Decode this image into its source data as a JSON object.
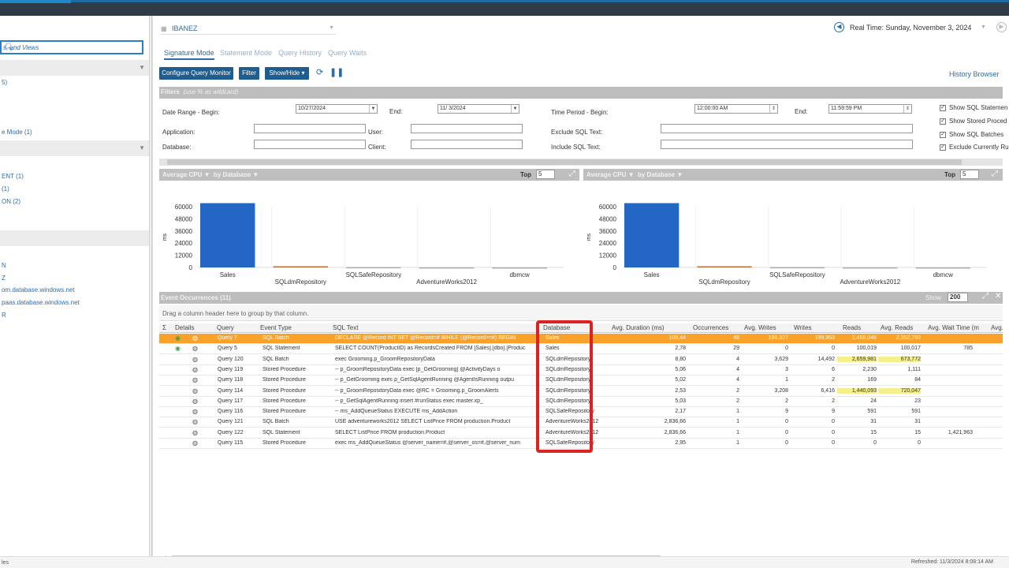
{
  "left_panel": {
    "search_placeholder": "s, and Views",
    "items": [
      {
        "label": "5)",
        "top": 80
      },
      {
        "label": "e Mode (1)",
        "top": 143
      },
      {
        "label": "ENT (1)",
        "top": 199
      },
      {
        "label": "(1)",
        "top": 215
      },
      {
        "label": "ON (2)",
        "top": 231
      },
      {
        "label": "N",
        "top": 312
      },
      {
        "label": "Z",
        "top": 328
      },
      {
        "label": "om.database.windows.net",
        "top": 343
      },
      {
        "label": "paas.database.windows.net",
        "top": 359
      },
      {
        "label": "R",
        "top": 375
      }
    ]
  },
  "header": {
    "server": "IBANEZ",
    "realtime": "Real Time: Sunday, November 3, 2024",
    "history_browser": "History Browser"
  },
  "tabs": [
    "Signature Mode",
    "Statement Mode",
    "Query History",
    "Query Waits"
  ],
  "toolbar": {
    "configure": "Configure Query Monitor",
    "filter": "Filter",
    "showhide": "Show/Hide ▾"
  },
  "filters": {
    "title": "Filters",
    "hint": "(use % as wildcard)",
    "date_begin_label": "Date Range - Begin:",
    "date_begin": "10/27/2024",
    "end_label": "End:",
    "date_end": "11/ 3/2024",
    "time_begin_label": "Time Period - Begin:",
    "time_begin": "12:00:00 AM",
    "time_end_label": "End:",
    "time_end": "11:59:59 PM",
    "application_label": "Application:",
    "user_label": "User:",
    "exclude_label": "Exclude SQL Text:",
    "database_label": "Database:",
    "client_label": "Client:",
    "include_label": "Include SQL Text:",
    "checks": [
      "Show SQL Statemen",
      "Show Stored Proced",
      "Show SQL Batches",
      "Exclude Currently Ru"
    ]
  },
  "chart_panels": [
    {
      "metric": "Average CPU",
      "by": "by Database",
      "top_label": "Top",
      "top_n": "5"
    },
    {
      "metric": "Average CPU",
      "by": "by Database",
      "top_label": "Top",
      "top_n": "5"
    }
  ],
  "chart_data": [
    {
      "type": "bar",
      "categories": [
        "Sales",
        "SQLdmRepository",
        "SQLSafeRepository",
        "AdventureWorks2012",
        "dbmcw"
      ],
      "values": [
        63500,
        1200,
        300,
        100,
        50
      ],
      "yticks": [
        "60000",
        "48000",
        "36000",
        "24000",
        "12000",
        "0"
      ],
      "ylabel": "ms",
      "ylim": [
        0,
        60000
      ],
      "colors": [
        "#2366c4",
        "#c0733a",
        "#a8a8a8",
        "#a8a8a8",
        "#a8a8a8"
      ]
    },
    {
      "type": "bar",
      "categories": [
        "Sales",
        "SQLdmRepository",
        "SQLSafeRepository",
        "AdventureWorks2012",
        "dbmcw"
      ],
      "values": [
        63500,
        1200,
        300,
        100,
        50
      ],
      "yticks": [
        "60000",
        "48000",
        "36000",
        "24000",
        "12000",
        "0"
      ],
      "ylabel": "ms",
      "ylim": [
        0,
        60000
      ],
      "colors": [
        "#2366c4",
        "#c0733a",
        "#a8a8a8",
        "#a8a8a8",
        "#a8a8a8"
      ]
    }
  ],
  "grid": {
    "title": "Event Occurrences (11)",
    "show_label": "Show",
    "show_n": "200",
    "group_hint": "Drag a column header here to group by that column.",
    "columns": [
      "Σ",
      "Details",
      "Query",
      "Event Type",
      "SQL Text",
      "Database",
      "Avg. Duration (ms)",
      "Occurrences",
      "Avg. Writes",
      "Writes",
      "Reads",
      "Avg. Reads",
      "Avg. Wait Time (m",
      "Avg."
    ],
    "rows": [
      {
        "query": "Query 7",
        "type": "SQL Batch",
        "sql": "DECLARE @Record INT  SET @Record=#  WHILE (@Record>=#)  BEGIN",
        "db": "Sales",
        "dur": "108,44",
        "occ": "48",
        "aw": "199,327",
        "w": "199,953",
        "r": "2,458,046",
        "ar": "2,352,793",
        "awt": ""
      },
      {
        "query": "Query 5",
        "type": "SQL Statement",
        "sql": "SELECT COUNT(ProductID) as RecordsCreated FROM [Sales].[dbo].[Produc",
        "db": "Sales",
        "dur": "2,78",
        "occ": "29",
        "aw": "0",
        "w": "0",
        "r": "100,019",
        "ar": "100,017",
        "awt": "785"
      },
      {
        "query": "Query 120",
        "type": "SQL Batch",
        "sql": "exec Grooming.p_GroomRepositoryData",
        "db": "SQLdmRepository",
        "dur": "8,80",
        "occ": "4",
        "aw": "3,629",
        "w": "14,492",
        "r": "2,659,981",
        "ar": "673,772",
        "awt": ""
      },
      {
        "query": "Query 119",
        "type": "Stored Procedure",
        "sql": "-- p_GroomRepositoryData exec [p_GetGrooming]      @ActivityDays o",
        "db": "SQLdmRepository",
        "dur": "5,06",
        "occ": "4",
        "aw": "3",
        "w": "6",
        "r": "2,230",
        "ar": "1,111",
        "awt": ""
      },
      {
        "query": "Query 118",
        "type": "Stored Procedure",
        "sql": "-- p_GetGrooming  exec p_GetSqlAgentRunning @AgentIsRunning outpu",
        "db": "SQLdmRepository",
        "dur": "5,02",
        "occ": "4",
        "aw": "1",
        "w": "2",
        "r": "169",
        "ar": "84",
        "awt": ""
      },
      {
        "query": "Query 114",
        "type": "Stored Procedure",
        "sql": "-- p_GroomRepositoryData exec @RC = Grooming.p_GroomAlerts",
        "db": "SQLdmRepository",
        "dur": "2,53",
        "occ": "2",
        "aw": "3,208",
        "w": "6,416",
        "r": "1,440,093",
        "ar": "720,047",
        "awt": ""
      },
      {
        "query": "Query 117",
        "type": "Stored Procedure",
        "sql": "-- p_GetSqlAgentRunning  insert #runStatus         exec master.xp_",
        "db": "SQLdmRepository",
        "dur": "5,03",
        "occ": "2",
        "aw": "2",
        "w": "2",
        "r": "24",
        "ar": "23",
        "awt": ""
      },
      {
        "query": "Query 116",
        "type": "Stored Procedure",
        "sql": "-- ms_AddQueueStatus  EXECUTE ms_AddAction",
        "db": "SQLSafeRepository",
        "dur": "2,17",
        "occ": "1",
        "aw": "9",
        "w": "9",
        "r": "591",
        "ar": "591",
        "awt": ""
      },
      {
        "query": "Query 121",
        "type": "SQL Batch",
        "sql": "USE adventureworks2012   SELECT ListPrice FROM production.Product",
        "db": "AdventureWorks2012",
        "dur": "2,836,66",
        "occ": "1",
        "aw": "0",
        "w": "0",
        "r": "31",
        "ar": "31",
        "awt": ""
      },
      {
        "query": "Query 122",
        "type": "SQL Statement",
        "sql": "SELECT ListPrice FROM production.Product",
        "db": "AdventureWorks2012",
        "dur": "2,836,66",
        "occ": "1",
        "aw": "0",
        "w": "0",
        "r": "15",
        "ar": "15",
        "awt": "1,421,963"
      },
      {
        "query": "Query 115",
        "type": "Stored Procedure",
        "sql": "exec ms_AddQueueStatus @server_name=#,@server_os=#,@server_num",
        "db": "SQLSafeRepository",
        "dur": "2,95",
        "occ": "1",
        "aw": "0",
        "w": "0",
        "r": "0",
        "ar": "0",
        "awt": ""
      }
    ]
  },
  "status": {
    "refreshed": "Refreshed: 11/3/2024 8:08:14 AM",
    "left": "les"
  }
}
